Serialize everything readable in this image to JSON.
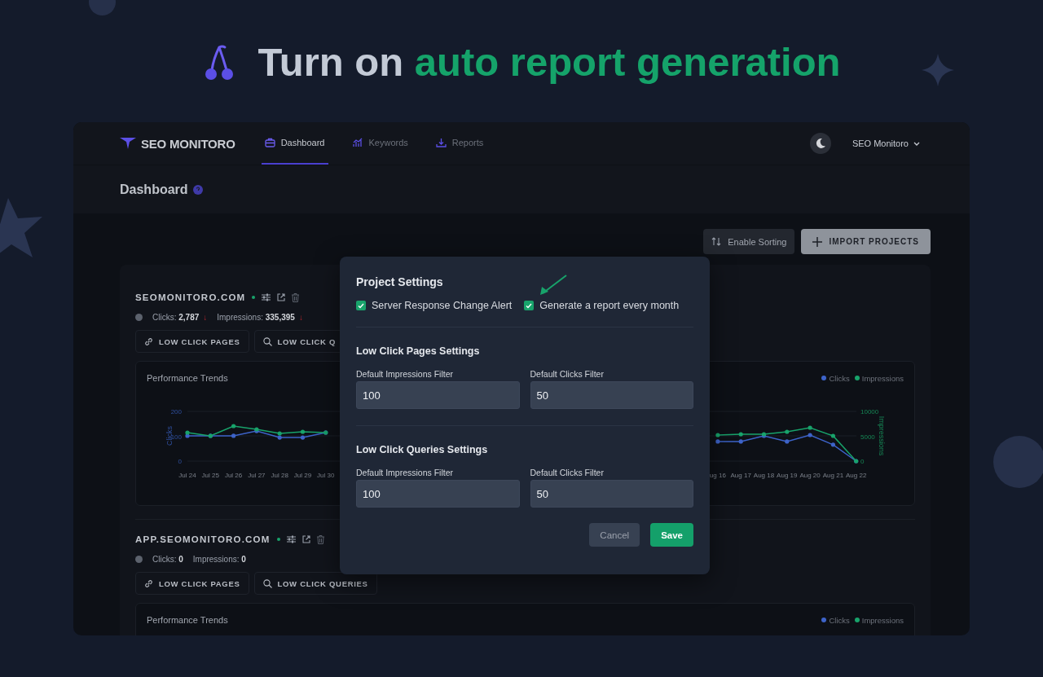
{
  "headline": {
    "lead": "Turn on",
    "highlight": "auto report generation"
  },
  "app": {
    "brand": "SEO MONITORO",
    "nav": [
      {
        "label": "Dashboard",
        "selected": true
      },
      {
        "label": "Keywords",
        "selected": false
      },
      {
        "label": "Reports",
        "selected": false
      }
    ],
    "account": "SEO Monitoro",
    "page_title": "Dashboard",
    "actions": [
      {
        "label": "Enable Sorting",
        "kind": "secondary"
      },
      {
        "label": "IMPORT PROJECTS",
        "kind": "primary"
      }
    ],
    "projects": [
      {
        "domain": "SEOMONITORO.COM",
        "stats": [
          {
            "label": "Clicks:",
            "value": "2,787",
            "trend": "↓"
          },
          {
            "label": "Impressions:",
            "value": "335,395",
            "trend": "↓"
          }
        ],
        "buttons": [
          {
            "label": "LOW CLICK PAGES",
            "kind": "link"
          },
          {
            "label": "LOW CLICK Q",
            "kind": "search"
          }
        ],
        "chart": {
          "title": "Performance Trends",
          "chart_data": {
            "type": "line",
            "ylabel": "Clicks",
            "yticks": [
              0,
              100,
              200
            ],
            "ylim": [
              0,
              200
            ],
            "y2label": "Impressions",
            "y2ticks": [
              0,
              5000,
              10000
            ],
            "y2lim": [
              0,
              10000
            ],
            "categories": [
              "Jul 24",
              "Jul 25",
              "Jul 26",
              "Jul 27",
              "Jul 28",
              "Jul 29",
              "Jul 30",
              null,
              null,
              null,
              null,
              null,
              null,
              null,
              null,
              null,
              null,
              null,
              null,
              null,
              null,
              null,
              null,
              "ug 16",
              "Aug 17",
              "Aug 18",
              "Aug 19",
              "Aug 20",
              "Aug 21",
              "Aug 22"
            ],
            "series": [
              {
                "name": "Clicks",
                "color": "#3d63c9",
                "values": [
                  102,
                  102,
                  102,
                  121,
                  95,
                  95,
                  115,
                  null,
                  null,
                  null,
                  null,
                  null,
                  null,
                  null,
                  null,
                  null,
                  null,
                  null,
                  null,
                  null,
                  null,
                  null,
                  null,
                  79,
                  79,
                  102,
                  79,
                  105,
                  66,
                  0
                ]
              },
              {
                "name": "Impressions",
                "color": "#18a36b",
                "axis": "y2",
                "values": [
                  5738,
                  5082,
                  7049,
                  6393,
                  5574,
                  5902,
                  5738,
                  null,
                  null,
                  null,
                  null,
                  null,
                  null,
                  null,
                  null,
                  null,
                  null,
                  null,
                  null,
                  null,
                  null,
                  null,
                  null,
                  5246,
                  5410,
                  5410,
                  5902,
                  6721,
                  5082,
                  0
                ]
              }
            ]
          }
        }
      },
      {
        "domain": "APP.SEOMONITORO.COM",
        "stats": [
          {
            "label": "Clicks:",
            "value": "0"
          },
          {
            "label": "Impressions:",
            "value": "0"
          }
        ],
        "buttons": [
          {
            "label": "LOW CLICK PAGES",
            "kind": "link"
          },
          {
            "label": "LOW CLICK QUERIES",
            "kind": "search"
          }
        ],
        "chart": {
          "title": "Performance Trends",
          "legend": [
            {
              "label": "Clicks",
              "color": "#3d63c9"
            },
            {
              "label": "Impressions",
              "color": "#18a36b"
            }
          ]
        }
      }
    ]
  },
  "modal": {
    "title": "Project Settings",
    "checks": [
      {
        "label": "Server Response Change Alert",
        "checked": true
      },
      {
        "label": "Generate a report every month",
        "checked": true
      }
    ],
    "sections": [
      {
        "title": "Low Click Pages Settings",
        "fields": [
          {
            "label": "Default Impressions Filter",
            "value": "100"
          },
          {
            "label": "Default Clicks Filter",
            "value": "50"
          }
        ]
      },
      {
        "title": "Low Click Queries Settings",
        "fields": [
          {
            "label": "Default Impressions Filter",
            "value": "100"
          },
          {
            "label": "Default Clicks Filter",
            "value": "50"
          }
        ]
      }
    ],
    "buttons": [
      {
        "label": "Cancel",
        "kind": "secondary"
      },
      {
        "label": "Save",
        "kind": "primary"
      }
    ]
  }
}
